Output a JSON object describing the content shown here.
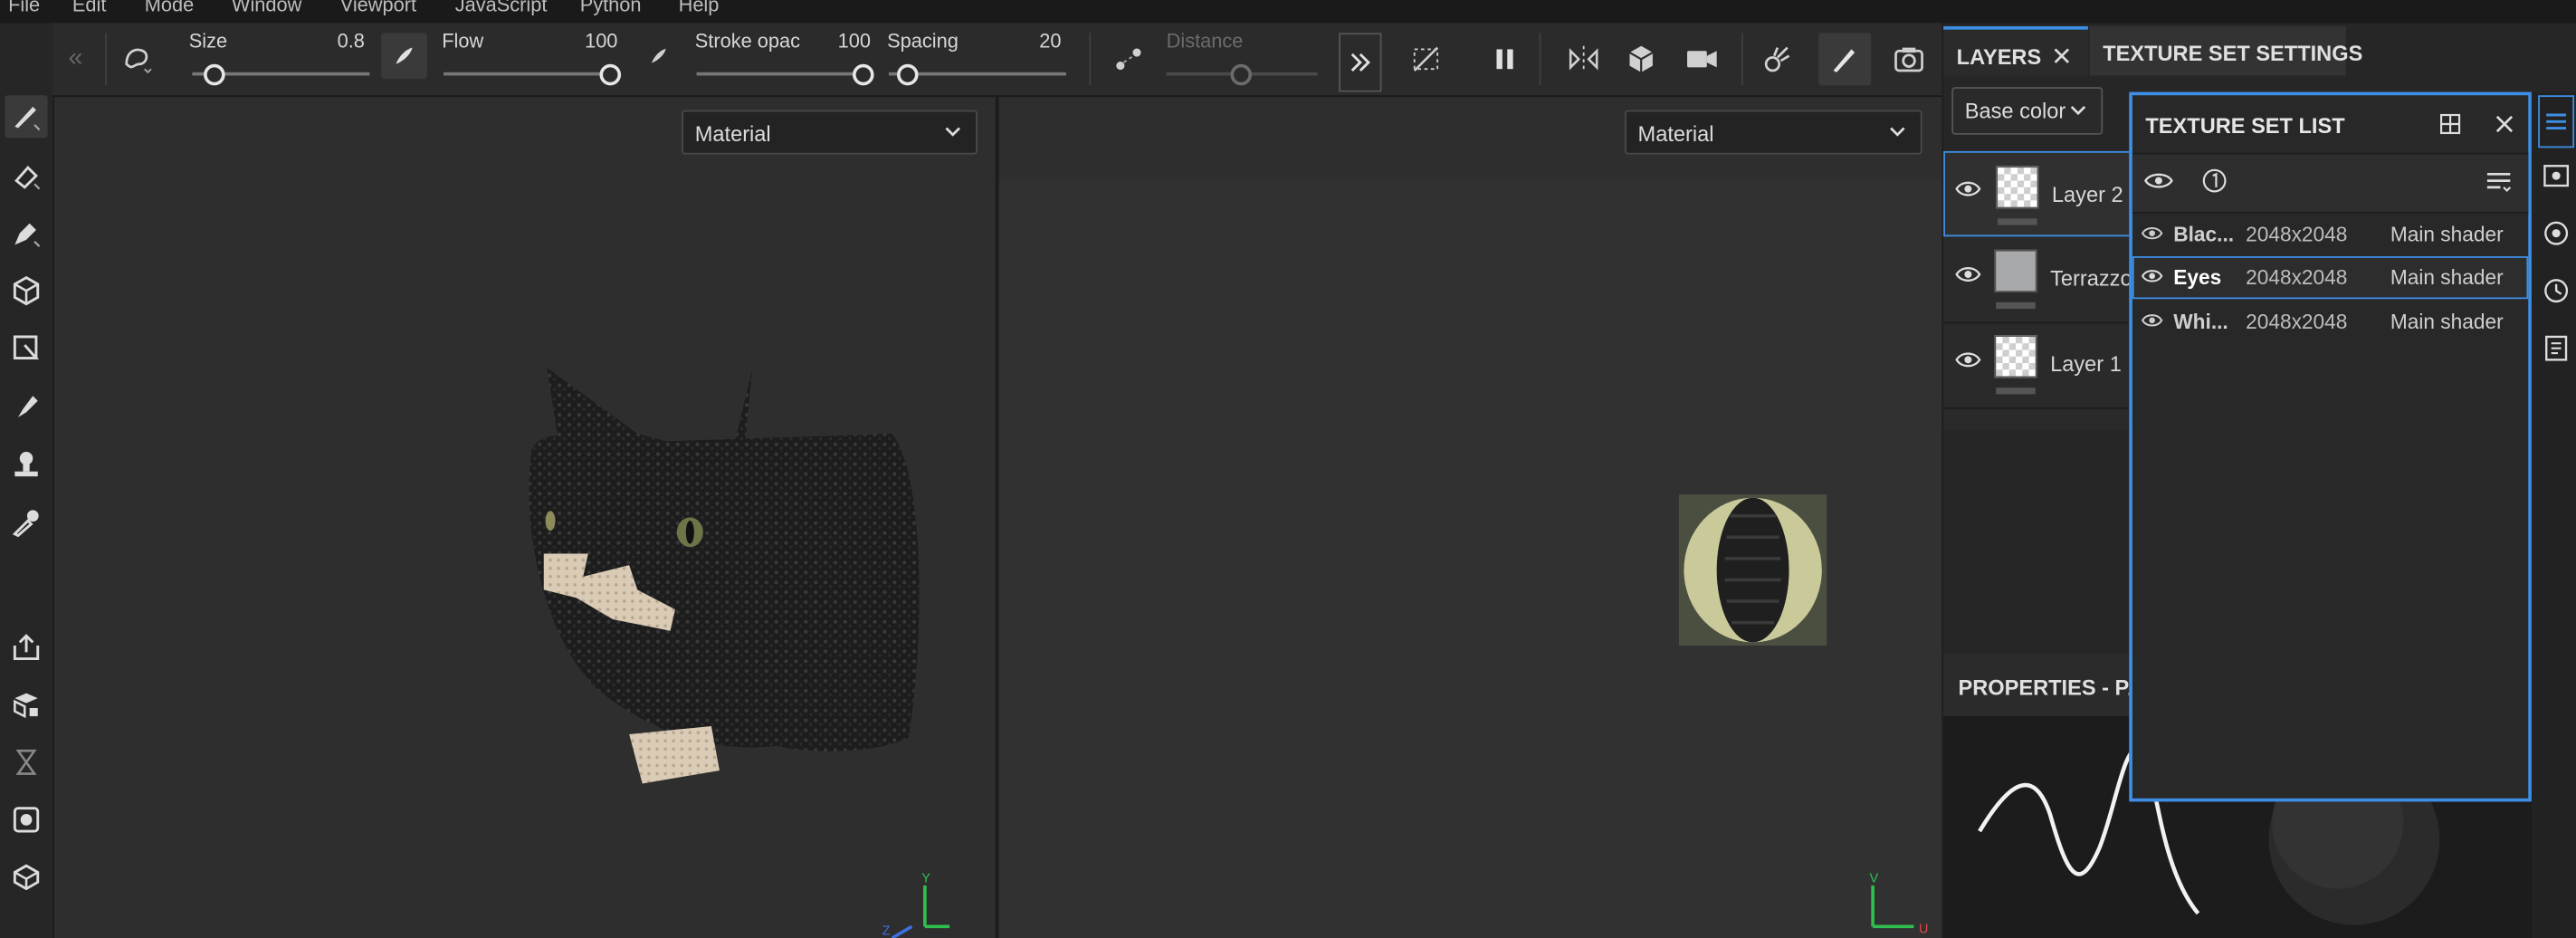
{
  "menu": [
    "File",
    "Edit",
    "Mode",
    "Window",
    "Viewport",
    "JavaScript",
    "Python",
    "Help"
  ],
  "toolbar": {
    "size_label": "Size",
    "size_value": "0.8",
    "flow_label": "Flow",
    "flow_value": "100",
    "stroke_label": "Stroke opac",
    "stroke_value": "100",
    "spacing_label": "Spacing",
    "spacing_value": "20",
    "distance_label": "Distance"
  },
  "viewport_left": {
    "mode": "Material"
  },
  "viewport_right": {
    "mode": "Material"
  },
  "tabs": {
    "layers": "LAYERS",
    "texture_set_settings": "TEXTURE SET SETTINGS"
  },
  "channel_select": "Base color",
  "layers": [
    {
      "name": "Layer 2",
      "thumb": "transparent",
      "selected": true
    },
    {
      "name": "Terrazzo",
      "thumb": "grey",
      "selected": false
    },
    {
      "name": "Layer 1",
      "thumb": "transparent",
      "selected": false
    }
  ],
  "properties_title": "PROPERTIES - PA",
  "texture_set_list": {
    "title": "TEXTURE SET LIST",
    "rows": [
      {
        "name": "Blac...",
        "resolution": "2048x2048",
        "shader": "Main shader",
        "selected": false
      },
      {
        "name": "Eyes",
        "resolution": "2048x2048",
        "shader": "Main shader",
        "selected": true
      },
      {
        "name": "Whi...",
        "resolution": "2048x2048",
        "shader": "Main shader",
        "selected": false
      }
    ]
  },
  "colors": {
    "accent": "#3d8fe6",
    "panel": "#262626",
    "viewport": "#2e2e2e"
  }
}
